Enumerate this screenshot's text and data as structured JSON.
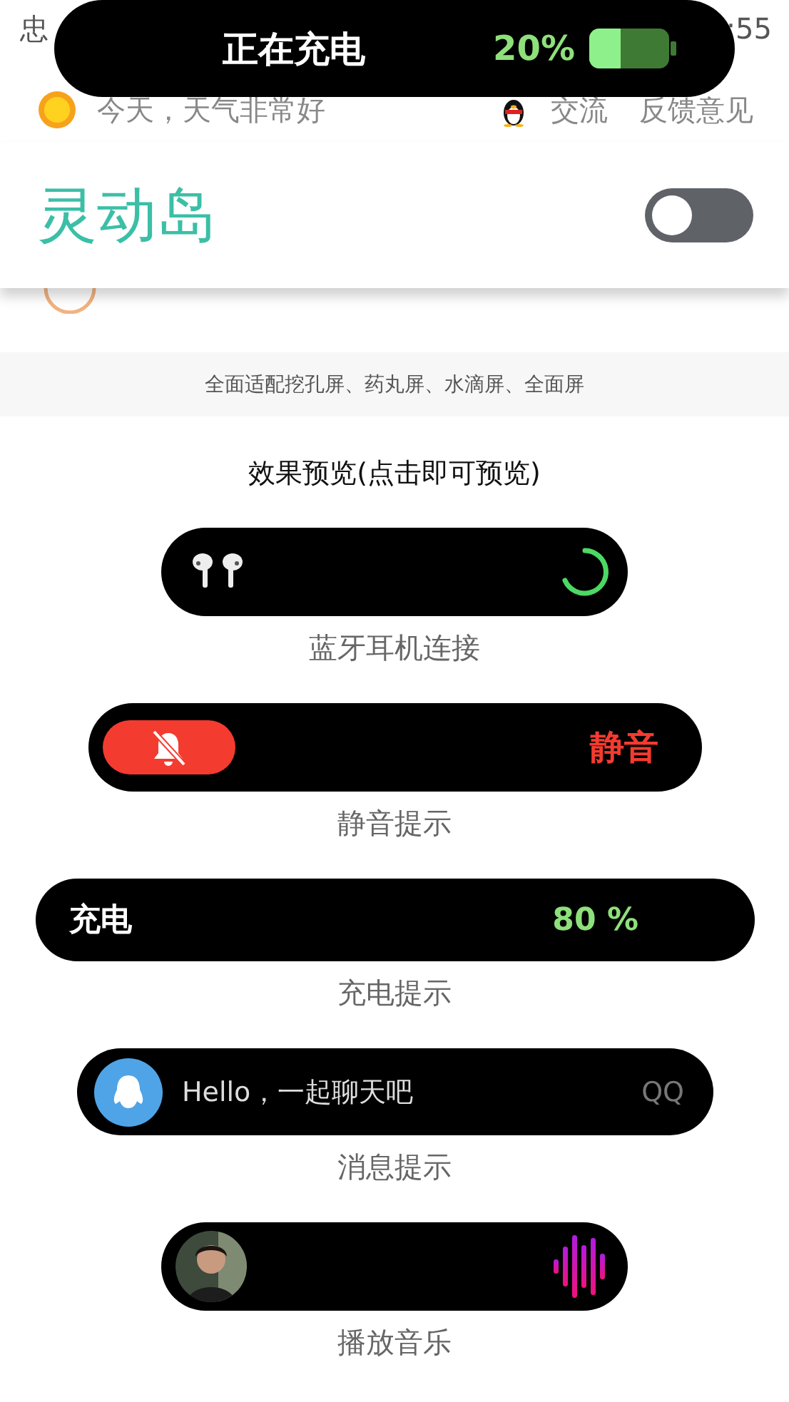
{
  "status_bar": {
    "left": "忠",
    "right": ":55"
  },
  "island": {
    "title": "正在充电",
    "reading": "20%"
  },
  "info_row": {
    "weather": "今天，天气非常好",
    "links": [
      "交流",
      "反馈意见"
    ]
  },
  "header": {
    "title": "灵动岛",
    "on": false
  },
  "notice": "全面适配挖孔屏、药丸屏、水滴屏、全面屏",
  "preview_title": "效果预览(点击即可预览)",
  "previews": [
    {
      "kind": "earbuds",
      "label": "蓝牙耳机连接"
    },
    {
      "kind": "mute",
      "label": "静音提示",
      "text": "静音"
    },
    {
      "kind": "charging",
      "label": "充电提示",
      "text": "充电",
      "reading": "80 %"
    },
    {
      "kind": "message",
      "label": "消息提示",
      "text": "Hello，一起聊天吧",
      "app": "QQ"
    },
    {
      "kind": "music",
      "label": "播放音乐"
    }
  ]
}
